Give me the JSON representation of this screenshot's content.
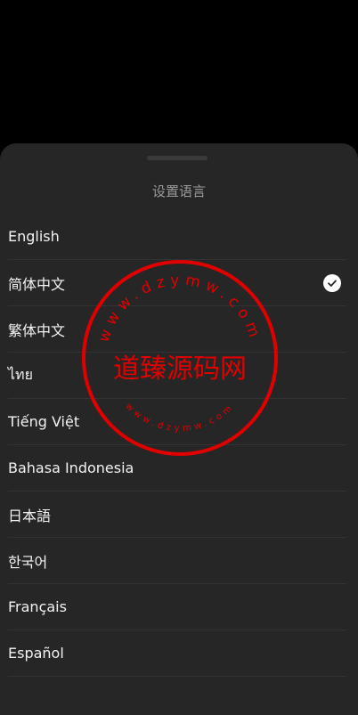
{
  "sheet": {
    "title": "设置语言"
  },
  "languages": [
    {
      "label": "English",
      "selected": false
    },
    {
      "label": "简体中文",
      "selected": true
    },
    {
      "label": "繁体中文",
      "selected": false
    },
    {
      "label": "ไทย",
      "selected": false
    },
    {
      "label": "Tiếng Việt",
      "selected": false
    },
    {
      "label": "Bahasa Indonesia",
      "selected": false
    },
    {
      "label": "日本語",
      "selected": false
    },
    {
      "label": "한국어",
      "selected": false
    },
    {
      "label": "Français",
      "selected": false
    },
    {
      "label": "Español",
      "selected": false
    }
  ],
  "watermark": {
    "main_text": "道臻源码网",
    "ring_text_top": "www.dzymw.com",
    "ring_text_bottom": "www.dzymw.com",
    "color": "#e00000"
  },
  "colors": {
    "background": "#000000",
    "sheet": "#262626",
    "text": "#f2f2f2",
    "title": "#9a9a9a",
    "divider": "#333333"
  },
  "icons": {
    "selected": "check-circle-icon"
  }
}
